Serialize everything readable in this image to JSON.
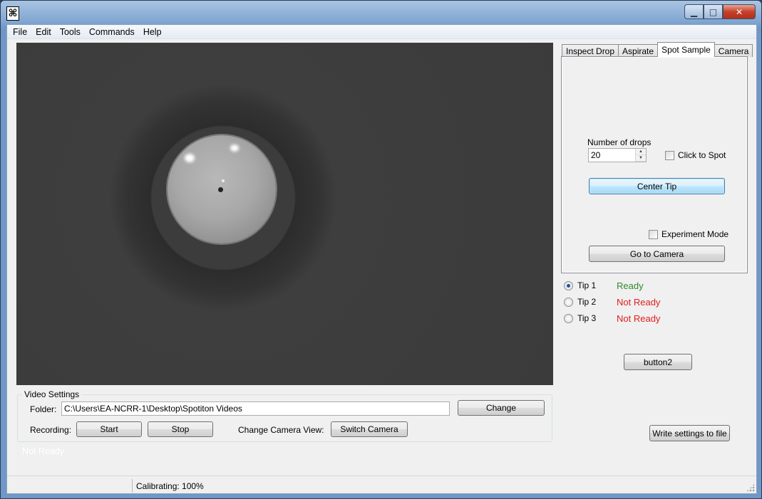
{
  "titlebar": {
    "app_icon": "app-logo-icon",
    "controls": {
      "minimize": "minimize-icon",
      "maximize": "maximize-icon",
      "close": "close-icon"
    }
  },
  "menu": [
    "File",
    "Edit",
    "Tools",
    "Commands",
    "Help"
  ],
  "video_settings": {
    "title": "Video Settings",
    "folder_label": "Folder:",
    "folder_value": "C:\\Users\\EA-NCRR-1\\Desktop\\Spotiton Videos",
    "change_label": "Change",
    "recording_label": "Recording:",
    "start_label": "Start",
    "stop_label": "Stop",
    "camera_view_label": "Change Camera View:",
    "switch_camera_label": "Switch Camera"
  },
  "overlay_status": "Not Ready",
  "tabs": [
    "Inspect Drop",
    "Aspirate",
    "Spot Sample",
    "Camera"
  ],
  "active_tab": "Spot Sample",
  "spot_sample": {
    "drops_label": "Number of drops",
    "drops_value": "20",
    "click_to_spot_label": "Click to Spot",
    "center_tip_label": "Center Tip",
    "experiment_mode_label": "Experiment Mode",
    "go_to_camera_label": "Go to Camera"
  },
  "tips": [
    {
      "label": "Tip 1",
      "status": "Ready",
      "selected": true
    },
    {
      "label": "Tip 2",
      "status": "Not Ready",
      "selected": false
    },
    {
      "label": "Tip 3",
      "status": "Not Ready",
      "selected": false
    }
  ],
  "button2_label": "button2",
  "write_settings_label": "Write settings to file",
  "statusbar": {
    "calibrating": "Calibrating: 100%"
  },
  "colors": {
    "ready": "#2e8b2e",
    "not_ready": "#e01e1e"
  }
}
